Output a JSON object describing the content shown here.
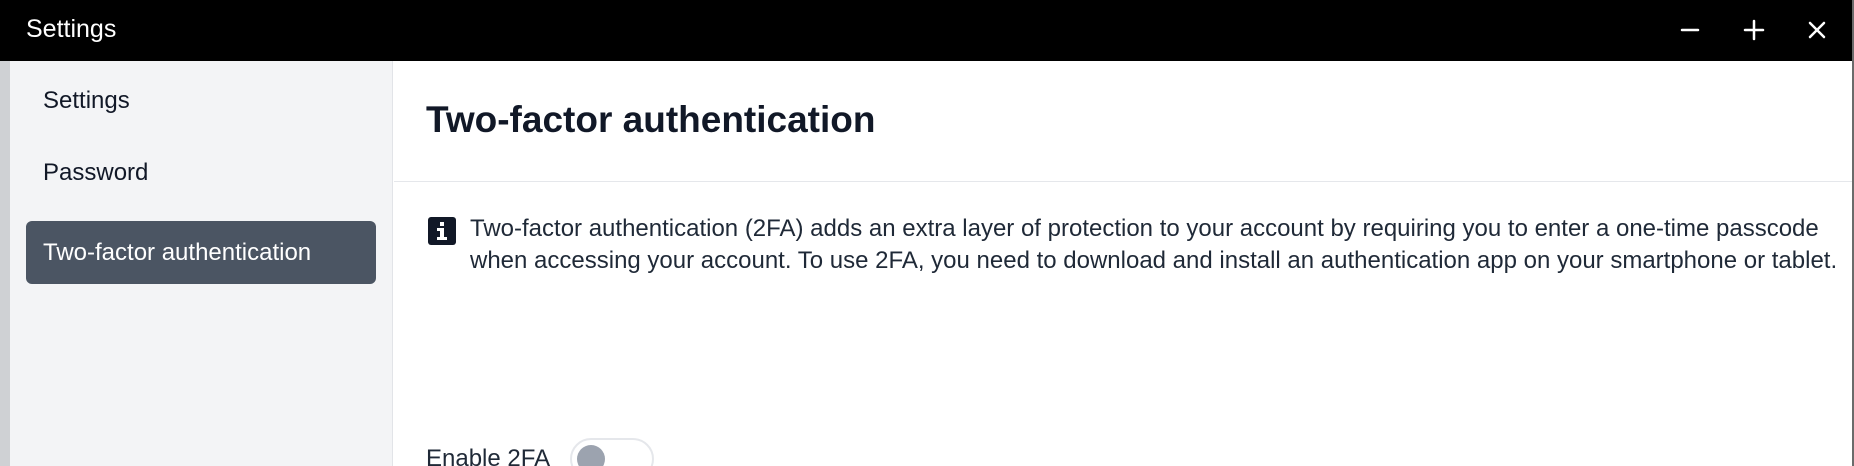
{
  "window": {
    "title": "Settings"
  },
  "sidebar": {
    "items": [
      {
        "label": "Settings",
        "active": false
      },
      {
        "label": "Password",
        "active": false
      },
      {
        "label": "Two-factor authentication",
        "active": true
      }
    ]
  },
  "main": {
    "title": "Two-factor authentication",
    "info": "Two-factor authentication (2FA) adds an extra layer of protection to your account by requiring you to enter a one-time passcode when accessing your account. To use 2FA, you need to download and install an authentication app on your smartphone or tablet.",
    "toggle": {
      "label": "Enable 2FA",
      "enabled": false
    }
  },
  "colors": {
    "titlebar": "#000000",
    "sidebar_bg": "#f3f4f6",
    "active_item_bg": "#4b5563",
    "toggle_knob": "#9ca3af"
  },
  "icons": [
    "minimize-icon",
    "maximize-icon",
    "close-icon",
    "info-icon"
  ]
}
